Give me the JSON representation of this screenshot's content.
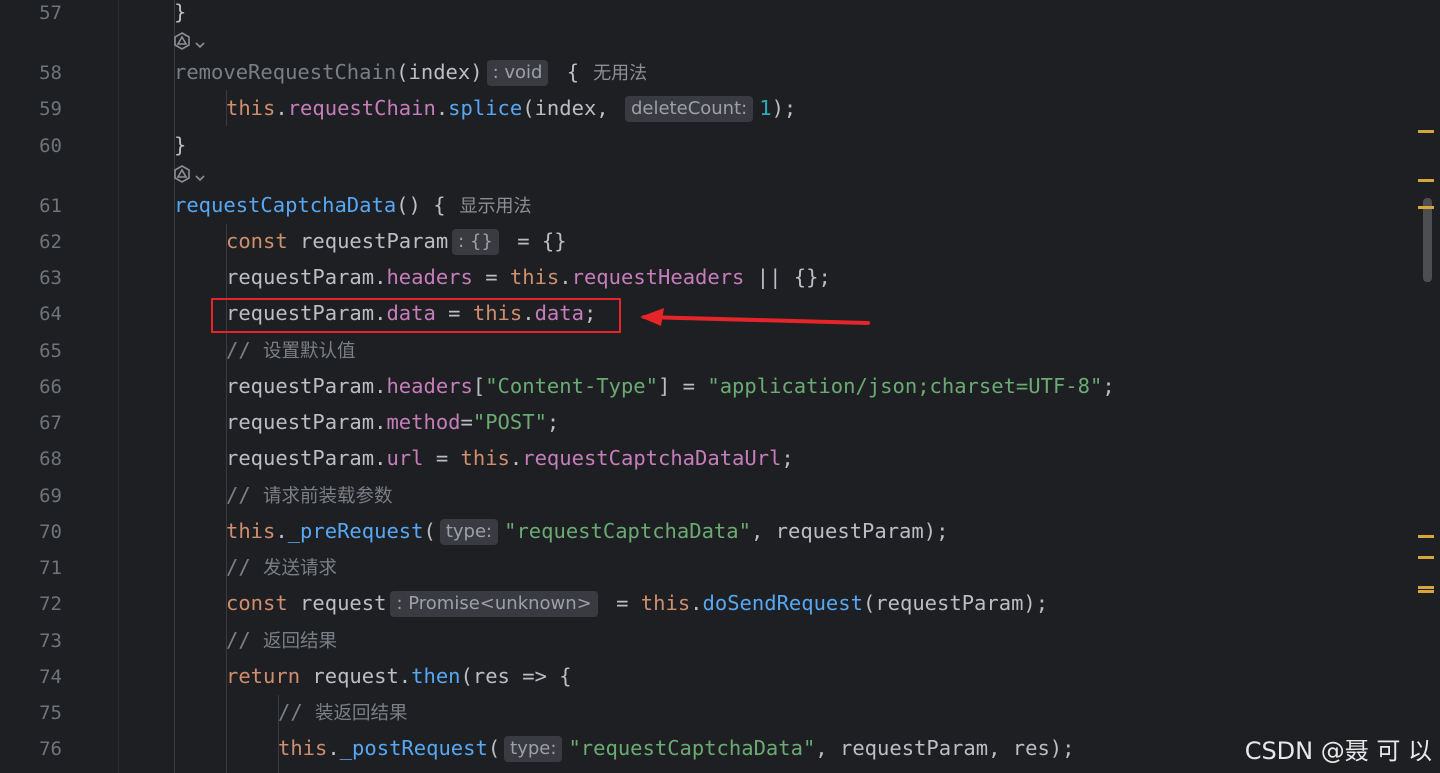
{
  "line_numbers": [
    "57",
    "58",
    "59",
    "60",
    "61",
    "62",
    "63",
    "64",
    "65",
    "66",
    "67",
    "68",
    "69",
    "70",
    "71",
    "72",
    "73",
    "74",
    "75",
    "76"
  ],
  "code": {
    "l57": "}",
    "l58_fn": "removeRequestChain",
    "l58_args": "(index)",
    "l58_hint": ": void",
    "l58_brace": " {",
    "l58_usage": "无用法",
    "l59_this": "this",
    "l59_prop": "requestChain",
    "l59_fn": "splice",
    "l59_args": "(index, ",
    "l59_hint_name": "deleteCount:",
    "l59_hint_val": "1",
    "l59_end": ");",
    "l60": "}",
    "l61_fn": "requestCaptchaData",
    "l61_args": "() {",
    "l61_usage": "显示用法",
    "l62_kw": "const",
    "l62_var": " requestParam",
    "l62_hint": ": {}",
    "l62_rest": " = {}",
    "l63_var": "requestParam.",
    "l63_prop": "headers",
    "l63_eq": " = ",
    "l63_this": "this",
    "l63_dot": ".",
    "l63_prop2": "requestHeaders",
    "l63_rest": " || {};",
    "l64_var": "requestParam.",
    "l64_prop": "data",
    "l64_eq": " = ",
    "l64_this": "this",
    "l64_dot": ".",
    "l64_prop2": "data",
    "l64_end": ";",
    "l65_slash": "// ",
    "l65_text": "设置默认值",
    "l66_var": "requestParam.",
    "l66_prop": "headers",
    "l66_b1": "[",
    "l66_str1": "\"Content-Type\"",
    "l66_b2": "] = ",
    "l66_str2": "\"application/json;charset=UTF-8\"",
    "l66_end": ";",
    "l67_var": "requestParam.",
    "l67_prop": "method",
    "l67_eq": "=",
    "l67_str": "\"POST\"",
    "l67_end": ";",
    "l68_var": "requestParam.",
    "l68_prop": "url",
    "l68_eq": " = ",
    "l68_this": "this",
    "l68_dot": ".",
    "l68_prop2": "requestCaptchaDataUrl",
    "l68_end": ";",
    "l69_slash": "// ",
    "l69_text": "请求前装载参数",
    "l70_this": "this",
    "l70_dot": ".",
    "l70_fn": "_preRequest",
    "l70_paren": "(",
    "l70_hint": "type:",
    "l70_str": "\"requestCaptchaData\"",
    "l70_rest": ", requestParam);",
    "l71_slash": "// ",
    "l71_text": "发送请求",
    "l72_kw": "const",
    "l72_var": " request",
    "l72_hint": ": Promise<unknown>",
    "l72_eq": " = ",
    "l72_this": "this",
    "l72_dot": ".",
    "l72_fn": "doSendRequest",
    "l72_rest": "(requestParam);",
    "l73_slash": "// ",
    "l73_text": "返回结果",
    "l74_kw": "return",
    "l74_var": " request.",
    "l74_fn": "then",
    "l74_rest": "(res => {",
    "l75_slash": "// ",
    "l75_text": "装返回结果",
    "l76_this": "this",
    "l76_dot": ".",
    "l76_fn": "_postRequest",
    "l76_paren": "(",
    "l76_hint": "type:",
    "l76_str": "\"requestCaptchaData\"",
    "l76_rest": ", requestParam, res);"
  },
  "icons": {
    "ai_action": "ai-assistant-icon",
    "chevron": "chevron-down-icon",
    "annotation_arrow": "red-arrow-icon"
  },
  "watermark": "CSDN @聂 可 以",
  "colors": {
    "background": "#1e1f22",
    "keyword": "#cf8e6d",
    "function": "#56a8f5",
    "property": "#c77dbb",
    "string": "#6aab73",
    "number": "#2aacb8",
    "comment": "#7a7e85",
    "highlight_box": "#e5252a"
  }
}
